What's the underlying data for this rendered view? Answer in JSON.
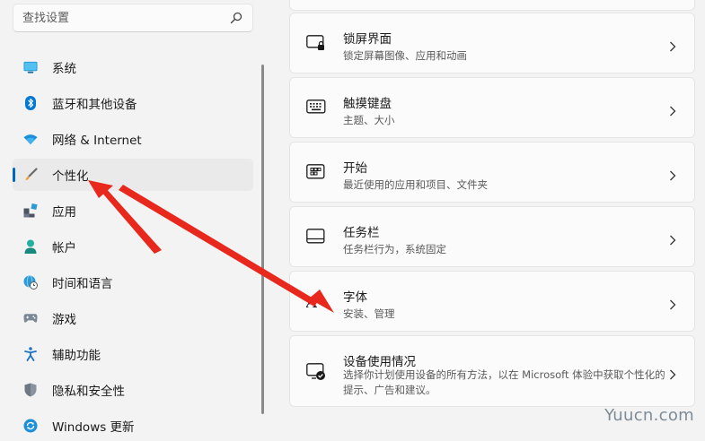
{
  "search": {
    "placeholder": "查找设置"
  },
  "sidebar": {
    "items": [
      {
        "label": "系统",
        "icon": "monitor-icon"
      },
      {
        "label": "蓝牙和其他设备",
        "icon": "bluetooth-icon"
      },
      {
        "label": "网络 & Internet",
        "icon": "wifi-icon"
      },
      {
        "label": "个性化",
        "icon": "brush-icon",
        "selected": true
      },
      {
        "label": "应用",
        "icon": "apps-icon"
      },
      {
        "label": "帐户",
        "icon": "person-icon"
      },
      {
        "label": "时间和语言",
        "icon": "globe-clock-icon"
      },
      {
        "label": "游戏",
        "icon": "gamepad-icon"
      },
      {
        "label": "辅助功能",
        "icon": "accessibility-icon"
      },
      {
        "label": "隐私和安全性",
        "icon": "shield-icon"
      },
      {
        "label": "Windows 更新",
        "icon": "update-icon"
      }
    ]
  },
  "cards": [
    {
      "title": "锁屏界面",
      "subtitle": "锁定屏幕图像、应用和动画",
      "icon": "lock-screen-icon"
    },
    {
      "title": "触摸键盘",
      "subtitle": "主题、大小",
      "icon": "keyboard-icon"
    },
    {
      "title": "开始",
      "subtitle": "最近使用的应用和项目、文件夹",
      "icon": "start-icon"
    },
    {
      "title": "任务栏",
      "subtitle": "任务栏行为，系统固定",
      "icon": "taskbar-icon"
    },
    {
      "title": "字体",
      "subtitle": "安装、管理",
      "icon": "font-icon"
    },
    {
      "title": "设备使用情况",
      "subtitle": "选择你计划使用设备的所有方法，以在 Microsoft 体验中获取个性化的提示、广告和建议。",
      "icon": "device-usage-icon"
    }
  ],
  "watermark": "Yuucn.com",
  "colors": {
    "accent": "#0067c0",
    "annotation_arrow": "#e8281c"
  }
}
